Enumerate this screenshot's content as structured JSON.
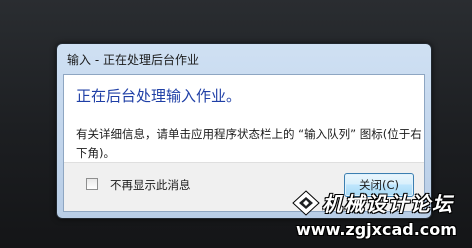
{
  "dialog": {
    "title": "输入 - 正在处理后台作业",
    "main_instruction": "正在后台处理输入作业。",
    "content": "有关详细信息，请单击应用程序状态栏上的 “输入队列” 图标(位于右下角)。",
    "checkbox_label": "不再显示此消息",
    "checkbox_checked": false,
    "close_button_label": "关闭(C)"
  },
  "watermark": {
    "title": "机械设计论坛",
    "url": "www.zgjxcad.com"
  },
  "colors": {
    "main_instruction": "#1f3fa6",
    "frame": "#c3d6ec",
    "button_border": "#3c7fb1"
  }
}
